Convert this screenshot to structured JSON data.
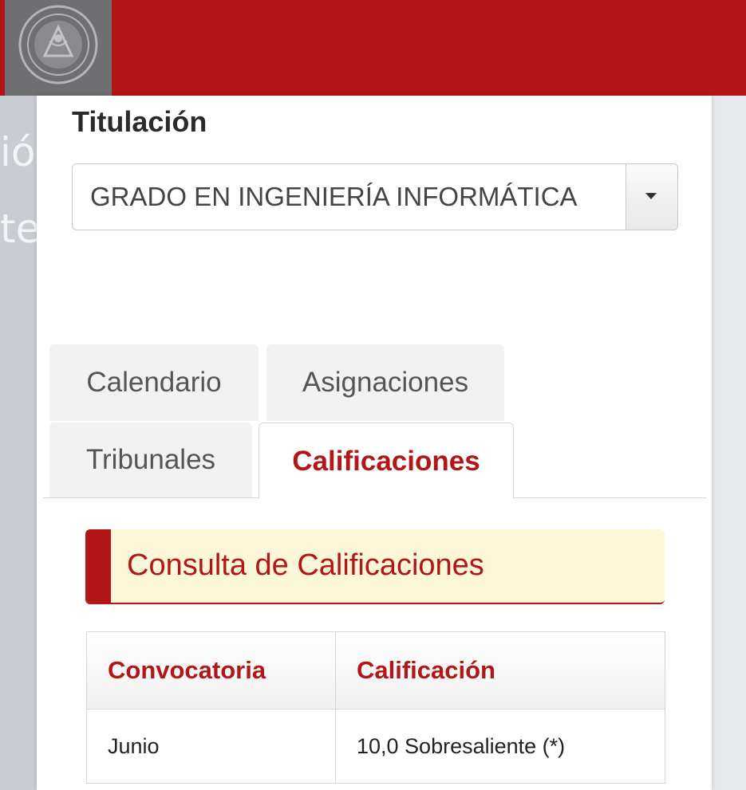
{
  "header": {
    "logo_icon": "university-seal-icon",
    "brand_color": "#b31616"
  },
  "form": {
    "titulacion_label": "Titulación",
    "titulacion_value": "GRADO EN INGENIERÍA INFORMÁTICA"
  },
  "tabs": [
    {
      "label": "Calendario",
      "active": false
    },
    {
      "label": "Asignaciones",
      "active": false
    },
    {
      "label": "Tribunales",
      "active": false
    },
    {
      "label": "Calificaciones",
      "active": true
    }
  ],
  "section": {
    "title": "Consulta de Calificaciones"
  },
  "grades_table": {
    "headers": [
      "Convocatoria",
      "Calificación"
    ],
    "rows": [
      [
        "Junio",
        "10,0 Sobresaliente (*)"
      ]
    ]
  }
}
